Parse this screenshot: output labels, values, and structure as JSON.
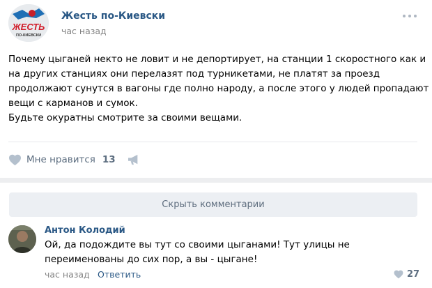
{
  "post": {
    "group_name": "Жесть по-Киевски",
    "time": "час назад",
    "logo_text": "ЖЕСТЬ",
    "logo_subtext": "ПО-КИЕВСКИ",
    "text_lines": [
      "Почему цыганей некто не ловит и не депортирует, на станции 1 скоростного как и",
      "на других станциях они перелазят под турникетами, не платят за проезд",
      "продолжают сунутся в вагоны где полно народу, а после этого у людей пропадают",
      "вещи с карманов и сумок.",
      "Будьте окуратны смотрите за своими вещами."
    ],
    "like_label": "Мне нравится",
    "like_count": "13",
    "icons": {
      "menu": "three-dots-icon",
      "like": "heart-icon",
      "share": "megaphone-icon"
    }
  },
  "comments_toggle": {
    "label": "Скрыть комментарии"
  },
  "comment": {
    "author": "Антон Колодий",
    "text_lines": [
      "Ой, да подождите вы тут со своими цыганами! Тут улицы не",
      "переименованы до сих пор, а вы - цыгане!"
    ],
    "time": "час назад",
    "reply_label": "Ответить",
    "like_count": "27"
  },
  "colors": {
    "link": "#2a5885",
    "meta": "#828282",
    "action": "#5d6e80",
    "icon": "#aeb7c2",
    "button_bg": "#eceff3",
    "divider": "#edeef0"
  }
}
